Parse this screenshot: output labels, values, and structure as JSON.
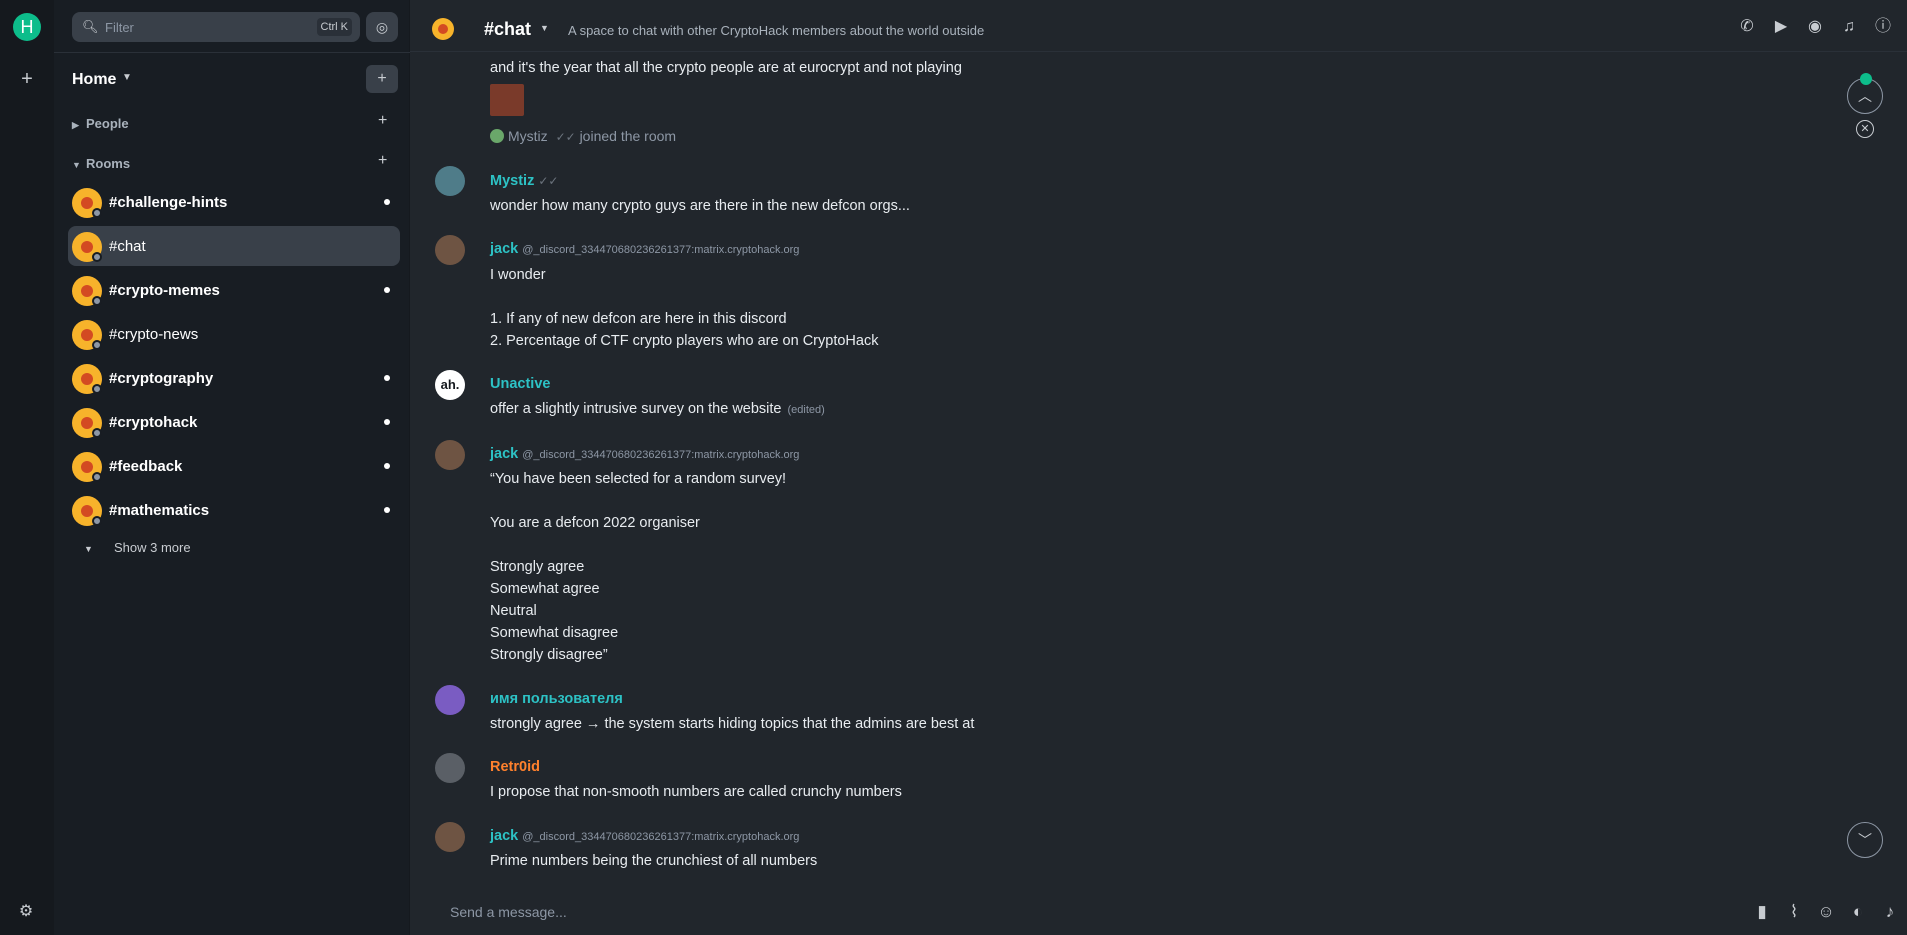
{
  "spaces": {
    "home_initial": "H"
  },
  "sidebar": {
    "filter_placeholder": "Filter",
    "filter_shortcut": "Ctrl K",
    "home_label": "Home",
    "people_label": "People",
    "rooms_label": "Rooms",
    "rooms": [
      {
        "name": "#challenge-hints",
        "bold": true,
        "unread": true,
        "selected": false
      },
      {
        "name": "#chat",
        "bold": false,
        "unread": false,
        "selected": true
      },
      {
        "name": "#crypto-memes",
        "bold": true,
        "unread": true,
        "selected": false
      },
      {
        "name": "#crypto-news",
        "bold": false,
        "unread": false,
        "selected": false
      },
      {
        "name": "#cryptography",
        "bold": true,
        "unread": true,
        "selected": false
      },
      {
        "name": "#cryptohack",
        "bold": true,
        "unread": true,
        "selected": false
      },
      {
        "name": "#feedback",
        "bold": true,
        "unread": true,
        "selected": false
      },
      {
        "name": "#mathematics",
        "bold": true,
        "unread": true,
        "selected": false
      }
    ],
    "show_more_label": "Show 3 more"
  },
  "header": {
    "room_name": "#chat",
    "topic": "A space to chat with other CryptoHack members about the world outside"
  },
  "timeline": {
    "first_line": "and it's the year that all the crypto people are at eurocrypt and not playing",
    "joined_name": "Mystiz",
    "joined_checks": "✓✓",
    "joined_text": "joined the room",
    "messages": [
      {
        "sender": "Mystiz",
        "checks": "✓✓",
        "mxid": "",
        "color": "#2dc2c5",
        "lines": [
          "wonder how many crypto guys are there in the new defcon orgs..."
        ]
      },
      {
        "sender": "jack",
        "checks": "",
        "mxid": "@_discord_334470680236261377:matrix.cryptohack.org",
        "color": "#2dc2c5",
        "lines": [
          "I wonder",
          "",
          "1. If any of new defcon are here in this discord",
          "2. Percentage of CTF crypto players who are on CryptoHack"
        ]
      },
      {
        "sender": "Unactive",
        "checks": "",
        "mxid": "",
        "color": "#2dc2c5",
        "lines": [
          "offer a slightly intrusive survey on the website"
        ],
        "edited": "(edited)"
      },
      {
        "sender": "jack",
        "checks": "",
        "mxid": "@_discord_334470680236261377:matrix.cryptohack.org",
        "color": "#2dc2c5",
        "lines": [
          "“You have been selected for a random survey!",
          "",
          "You are a defcon 2022 organiser",
          "",
          "Strongly agree",
          "Somewhat agree",
          "Neutral",
          "Somewhat disagree",
          "Strongly disagree”"
        ]
      },
      {
        "sender": "имя пользователя",
        "checks": "",
        "mxid": "",
        "color": "#2dc2c5",
        "lines": [
          "strongly agree → the system starts hiding topics that the admins are best at"
        ]
      },
      {
        "sender": "Retr0id",
        "checks": "",
        "mxid": "",
        "color": "#ff812d",
        "lines": [
          "I propose that non-smooth numbers are called crunchy numbers"
        ]
      },
      {
        "sender": "jack",
        "checks": "",
        "mxid": "@_discord_334470680236261377:matrix.cryptohack.org",
        "color": "#2dc2c5",
        "lines": [
          "Prime numbers being the crunchiest of all numbers"
        ]
      }
    ]
  },
  "composer": {
    "placeholder": "Send a message..."
  }
}
